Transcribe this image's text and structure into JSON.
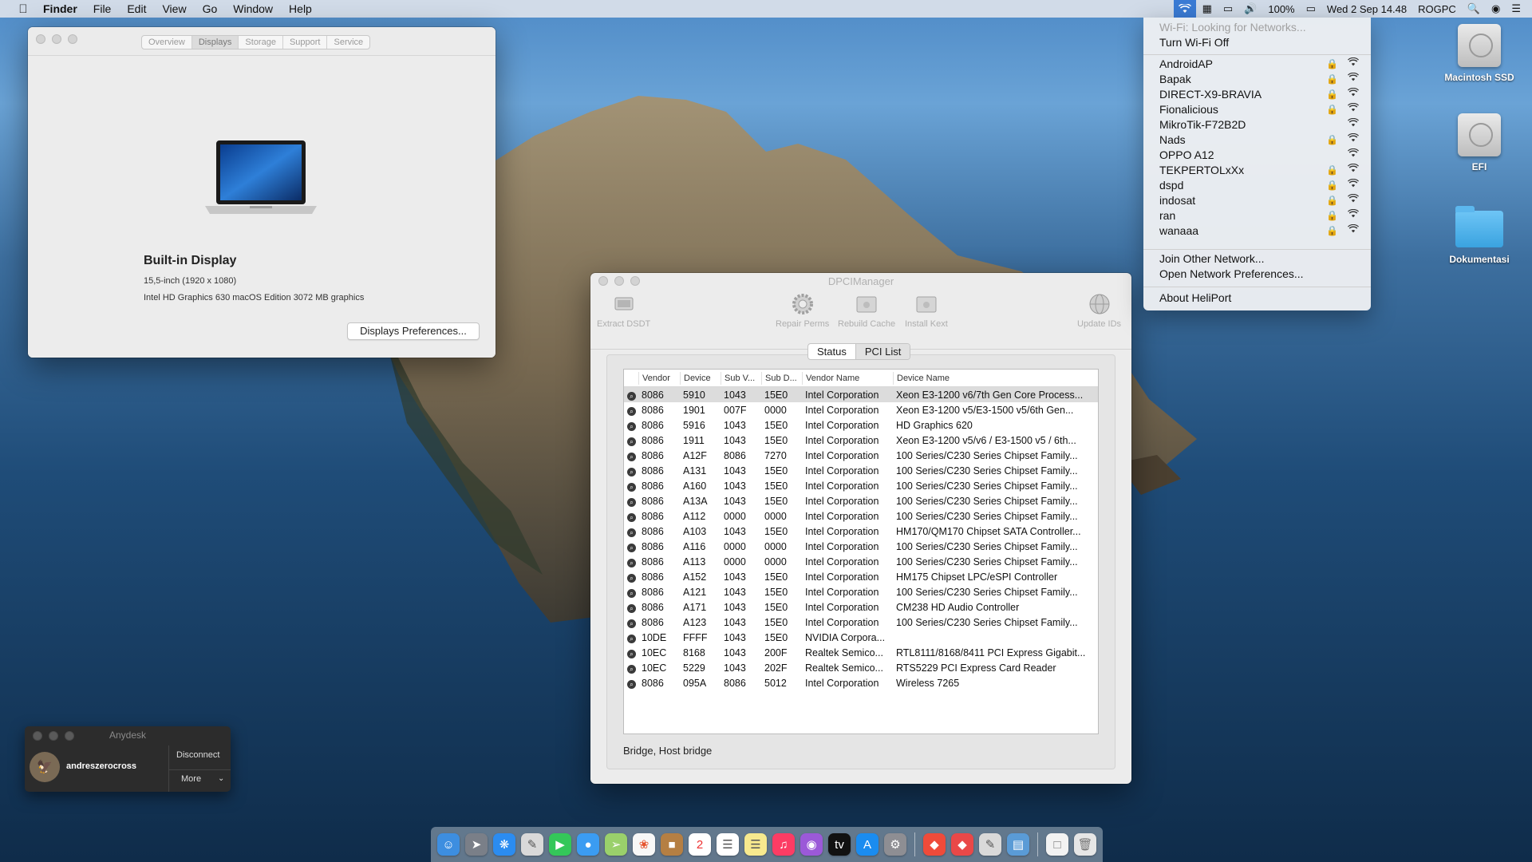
{
  "menubar": {
    "app_name": "Finder",
    "menus": [
      "File",
      "Edit",
      "View",
      "Go",
      "Window",
      "Help"
    ],
    "battery": "100%",
    "datetime": "Wed 2 Sep  14.48",
    "user": "ROGPC"
  },
  "about_window": {
    "tabs": [
      "Overview",
      "Displays",
      "Storage",
      "Support",
      "Service"
    ],
    "active_tab": "Displays",
    "display_title": "Built-in Display",
    "resolution": "15,5-inch (1920 x 1080)",
    "graphics": "Intel HD Graphics 630 macOS Edition 3072 MB graphics",
    "prefs_button": "Displays Preferences..."
  },
  "dpci": {
    "title": "DPCIManager",
    "toolbar": {
      "extract": "Extract DSDT",
      "repair": "Repair Perms",
      "rebuild": "Rebuild Cache",
      "install": "Install Kext",
      "update": "Update IDs"
    },
    "tabs": {
      "status": "Status",
      "pci_list": "PCI List"
    },
    "columns": [
      "Vendor",
      "Device",
      "Sub V...",
      "Sub D...",
      "Vendor Name",
      "Device Name"
    ],
    "rows": [
      [
        "8086",
        "5910",
        "1043",
        "15E0",
        "Intel Corporation",
        "Xeon E3-1200 v6/7th Gen Core Process..."
      ],
      [
        "8086",
        "1901",
        "007F",
        "0000",
        "Intel Corporation",
        "Xeon E3-1200 v5/E3-1500 v5/6th Gen..."
      ],
      [
        "8086",
        "5916",
        "1043",
        "15E0",
        "Intel Corporation",
        "HD Graphics 620"
      ],
      [
        "8086",
        "1911",
        "1043",
        "15E0",
        "Intel Corporation",
        "Xeon E3-1200 v5/v6 / E3-1500 v5 / 6th..."
      ],
      [
        "8086",
        "A12F",
        "8086",
        "7270",
        "Intel Corporation",
        "100 Series/C230 Series Chipset Family..."
      ],
      [
        "8086",
        "A131",
        "1043",
        "15E0",
        "Intel Corporation",
        "100 Series/C230 Series Chipset Family..."
      ],
      [
        "8086",
        "A160",
        "1043",
        "15E0",
        "Intel Corporation",
        "100 Series/C230 Series Chipset Family..."
      ],
      [
        "8086",
        "A13A",
        "1043",
        "15E0",
        "Intel Corporation",
        "100 Series/C230 Series Chipset Family..."
      ],
      [
        "8086",
        "A112",
        "0000",
        "0000",
        "Intel Corporation",
        "100 Series/C230 Series Chipset Family..."
      ],
      [
        "8086",
        "A103",
        "1043",
        "15E0",
        "Intel Corporation",
        "HM170/QM170 Chipset SATA Controller..."
      ],
      [
        "8086",
        "A116",
        "0000",
        "0000",
        "Intel Corporation",
        "100 Series/C230 Series Chipset Family..."
      ],
      [
        "8086",
        "A113",
        "0000",
        "0000",
        "Intel Corporation",
        "100 Series/C230 Series Chipset Family..."
      ],
      [
        "8086",
        "A152",
        "1043",
        "15E0",
        "Intel Corporation",
        "HM175 Chipset LPC/eSPI Controller"
      ],
      [
        "8086",
        "A121",
        "1043",
        "15E0",
        "Intel Corporation",
        "100 Series/C230 Series Chipset Family..."
      ],
      [
        "8086",
        "A171",
        "1043",
        "15E0",
        "Intel Corporation",
        "CM238 HD Audio Controller"
      ],
      [
        "8086",
        "A123",
        "1043",
        "15E0",
        "Intel Corporation",
        "100 Series/C230 Series Chipset Family..."
      ],
      [
        "10DE",
        "FFFF",
        "1043",
        "15E0",
        "NVIDIA Corpora...",
        ""
      ],
      [
        "10EC",
        "8168",
        "1043",
        "200F",
        "Realtek Semico...",
        "RTL8111/8168/8411 PCI Express Gigabit..."
      ],
      [
        "10EC",
        "5229",
        "1043",
        "202F",
        "Realtek Semico...",
        "RTS5229 PCI Express Card Reader"
      ],
      [
        "8086",
        "095A",
        "8086",
        "5012",
        "Intel Corporation",
        "Wireless 7265"
      ]
    ],
    "status_text": "Bridge, Host bridge"
  },
  "wifi_menu": {
    "status": "Wi-Fi: Looking for Networks...",
    "toggle": "Turn Wi-Fi Off",
    "networks": [
      {
        "name": "AndroidAP",
        "locked": true
      },
      {
        "name": "Bapak",
        "locked": true
      },
      {
        "name": "DIRECT-X9-BRAVIA",
        "locked": true
      },
      {
        "name": "Fionalicious",
        "locked": true
      },
      {
        "name": "MikroTik-F72B2D",
        "locked": false
      },
      {
        "name": "Nads",
        "locked": true
      },
      {
        "name": "OPPO A12",
        "locked": false
      },
      {
        "name": "TEKPERTOLxXx",
        "locked": true
      },
      {
        "name": "dspd",
        "locked": true
      },
      {
        "name": "indosat",
        "locked": true
      },
      {
        "name": "ran",
        "locked": true
      },
      {
        "name": "wanaaa",
        "locked": true
      }
    ],
    "join_other": "Join Other Network...",
    "open_prefs": "Open Network Preferences...",
    "about": "About HeliPort"
  },
  "desktop_icons": {
    "macintosh_ssd": "Macintosh SSD",
    "efi": "EFI",
    "dokumentasi": "Dokumentasi"
  },
  "anydesk": {
    "title": "Anydesk",
    "user": "andreszerocross",
    "disconnect": "Disconnect",
    "more": "More"
  },
  "colors": {
    "menu_highlight": "#3a7bd5",
    "folder": "#3aa3e0"
  }
}
